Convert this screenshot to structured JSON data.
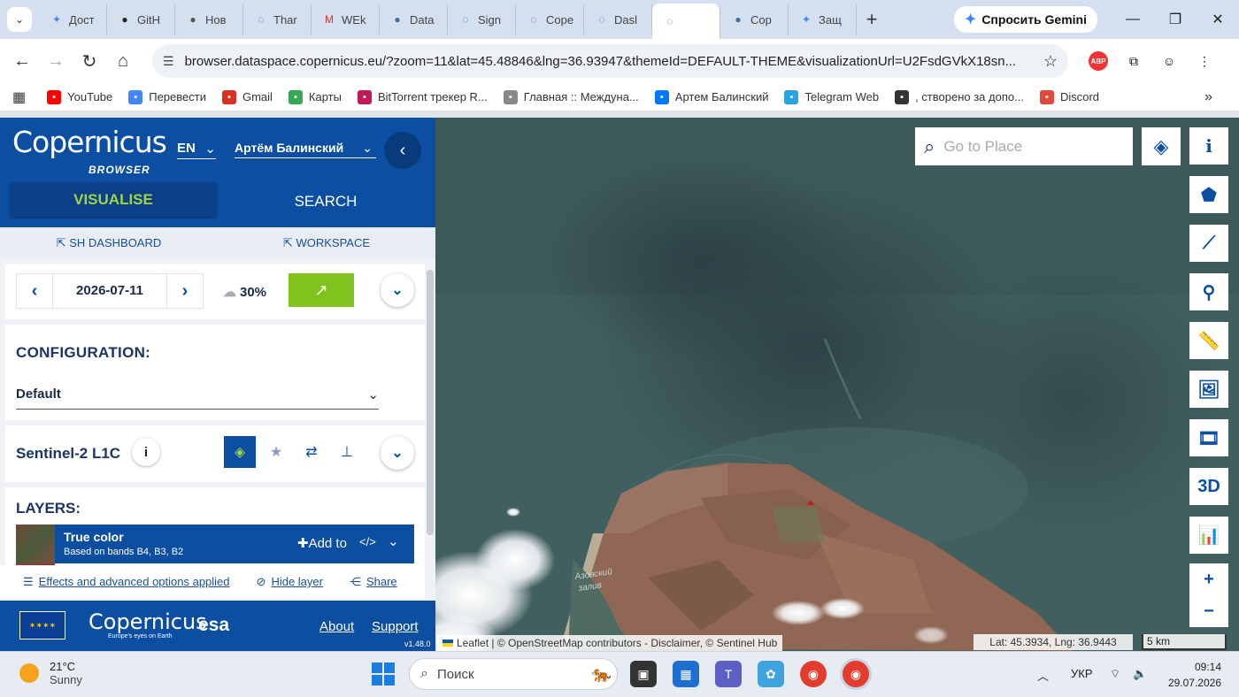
{
  "browser": {
    "tabs": [
      {
        "label": "Дост",
        "icon": "gemini-icon",
        "color": "#4285f4"
      },
      {
        "label": "GitH",
        "icon": "github-icon",
        "color": "#222222"
      },
      {
        "label": "Нов",
        "icon": "chrome-icon",
        "color": "#555555"
      },
      {
        "label": "Thar",
        "icon": "loading-icon",
        "color": "#1a73e8"
      },
      {
        "label": "WEk",
        "icon": "gmail-icon",
        "color": "#d93025"
      },
      {
        "label": "Data",
        "icon": "globe-icon",
        "color": "#3a6ea5"
      },
      {
        "label": "Sign",
        "icon": "loading-icon",
        "color": "#1a73e8"
      },
      {
        "label": "Cope",
        "icon": "loading-icon",
        "color": "#1a73e8"
      },
      {
        "label": "Dasl",
        "icon": "loading-icon",
        "color": "#1a73e8"
      },
      {
        "label": "",
        "icon": "loading-icon",
        "color": "#1a73e8",
        "active": true
      },
      {
        "label": "Cop",
        "icon": "globe-icon",
        "color": "#3a6ea5"
      },
      {
        "label": "Защ",
        "icon": "gemini-icon",
        "color": "#4285f4"
      }
    ],
    "new_tab": "+",
    "gemini_button": "Спросить Gemini",
    "url": "browser.dataspace.copernicus.eu/?zoom=11&lat=45.48846&lng=36.93947&themeId=DEFAULT-THEME&visualizationUrl=U2FsdGVkX18sn...",
    "bookmarks": [
      {
        "label": "YouTube",
        "icon": "youtube-icon",
        "color": "#ff0000"
      },
      {
        "label": "Перевести",
        "icon": "translate-icon",
        "color": "#4285f4"
      },
      {
        "label": "Gmail",
        "icon": "gmail-icon",
        "color": "#d93025"
      },
      {
        "label": "Карты",
        "icon": "maps-icon",
        "color": "#34a853"
      },
      {
        "label": "BitTorrent трекер R...",
        "icon": "bittorrent-icon",
        "color": "#c2185b"
      },
      {
        "label": "Главная :: Междуна...",
        "icon": "star-icon",
        "color": "#888888"
      },
      {
        "label": "Артем Балинский",
        "icon": "vk-icon",
        "color": "#0077ff"
      },
      {
        "label": "Telegram Web",
        "icon": "telegram-icon",
        "color": "#2aa3df"
      },
      {
        "label": ", створено за допо...",
        "icon": "github-icon",
        "color": "#333333"
      },
      {
        "label": "Discord",
        "icon": "discord-icon",
        "color": "#e0483c"
      }
    ]
  },
  "sidebar": {
    "logo": "opernicus",
    "logo_prefix": "C",
    "logo_sub": "BROWSER",
    "lang": "EN",
    "user": "Артём Балинский",
    "tab_visualise": "VISUALISE",
    "tab_search": "SEARCH",
    "link_dashboard": "SH DASHBOARD",
    "link_workspace": "WORKSPACE",
    "date": "2026-07-11",
    "cloud": "30%",
    "config_title": "CONFIGURATION:",
    "config_value": "Default",
    "collection": "Sentinel-2 L1C",
    "layers_title": "LAYERS:",
    "layer": {
      "name": "True color",
      "desc": "Based on bands B4, B3, B2",
      "add": "Add to",
      "code": "</>"
    },
    "effects": "Effects and advanced options applied",
    "hide_layer": "Hide layer",
    "share": "Share",
    "footer": {
      "logo": "opernicus",
      "logo_prefix": "C",
      "logo_sub": "Europe's eyes on Earth",
      "esa": "esa",
      "about": "About",
      "support": "Support",
      "version": "v1.48.0"
    }
  },
  "map": {
    "search_placeholder": "Go to Place",
    "zoom_in": "+",
    "zoom_out": "−",
    "tool_3d": "3D",
    "label_lagoon": "Азовский залив",
    "attribution": "Leaflet | © OpenStreetMap contributors - Disclaimer, © Sentinel Hub",
    "coords": "Lat: 45.3934, Lng: 36.9443",
    "scale": "5 km"
  },
  "taskbar": {
    "temp": "21°C",
    "weather": "Sunny",
    "search": "Поиск",
    "lang": "УКР",
    "time": "09:14",
    "date": "29.07.2026"
  }
}
